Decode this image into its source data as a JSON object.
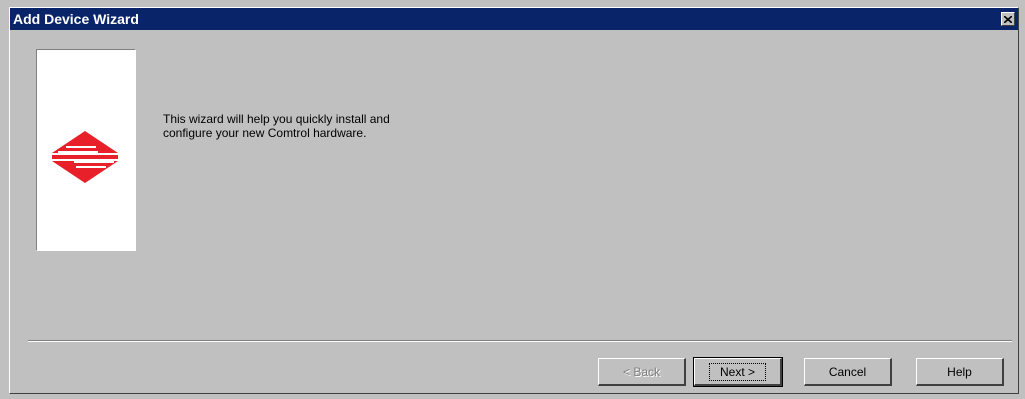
{
  "window": {
    "title": "Add Device Wizard"
  },
  "titlebar": {
    "close_icon": "close-icon"
  },
  "logo": {
    "icon": "comtrol-logo-icon",
    "color": "#e8202a"
  },
  "intro": {
    "text": "This wizard will help you quickly install and\nconfigure your new Comtrol hardware."
  },
  "buttons": {
    "back": "< Back",
    "next": "Next >",
    "cancel": "Cancel",
    "help": "Help"
  },
  "colors": {
    "titlebar": "#0a246a",
    "face": "#c0c0c0"
  }
}
